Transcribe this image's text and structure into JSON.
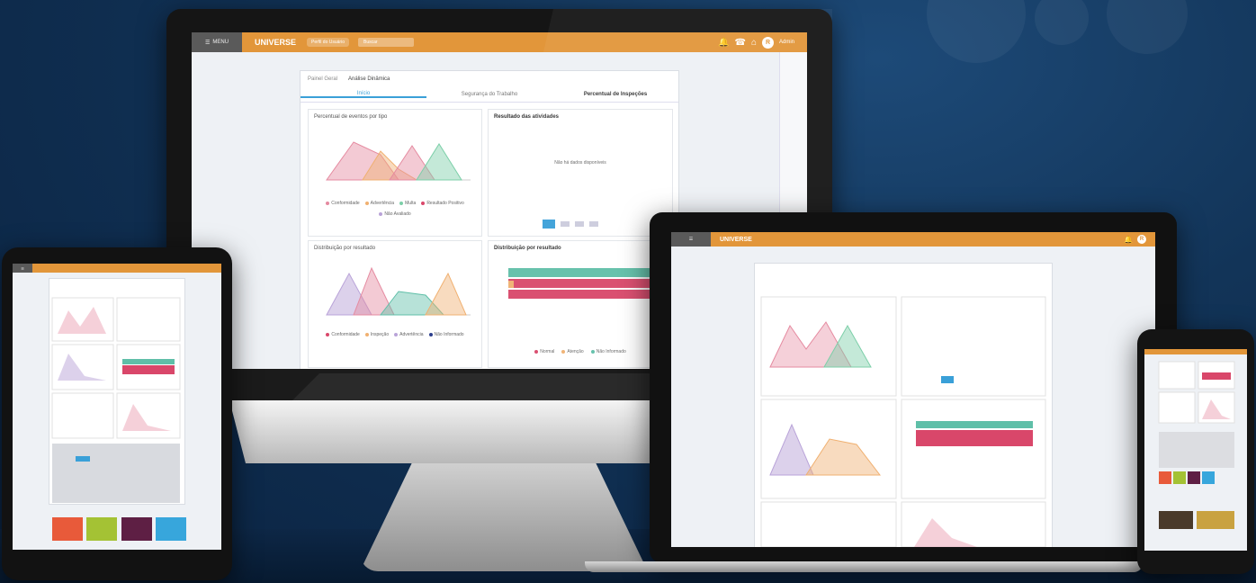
{
  "app": {
    "menu_label": "MENU",
    "logo": "UNIVERSE",
    "nav_pill": "Perfil do Usuário",
    "search_placeholder": "Buscar",
    "user_avatar": "R",
    "username": "Admin"
  },
  "panel": {
    "breadcrumb": "Painel Geral",
    "title": "Análise Dinâmica",
    "tabs": [
      "Início",
      "Segurança do Trabalho",
      "Percentual de Inspeções"
    ]
  },
  "cards": {
    "card1_title": "Percentual de eventos por tipo",
    "card2_title": "Resultado das atividades",
    "card2_empty": "Não há dados disponíveis",
    "card3_title": "Distribuição por resultado",
    "card4_title": "Distribuição por resultado"
  },
  "legends": {
    "l1": [
      "Conformidade",
      "Advertência",
      "Multa",
      "Resultado Positivo",
      "Não Avaliado"
    ],
    "l3": [
      "Conformidade",
      "Inspeção",
      "Advertência",
      "Não Informado"
    ],
    "l4": [
      "Normal",
      "Atenção",
      "Não Informado"
    ]
  },
  "colors": {
    "topbar": "#e2963a",
    "accent": "#3aa0d8",
    "pink": "#e58aa0",
    "orange": "#f0b070",
    "green": "#7ccfa8",
    "purple": "#b9a3d8",
    "teal": "#5fbfa8",
    "crimson": "#d9476a"
  },
  "icons": [
    "menu-icon",
    "bell-icon",
    "phone-icon",
    "home-icon",
    "user-icon",
    "settings-icon",
    "close-icon"
  ]
}
